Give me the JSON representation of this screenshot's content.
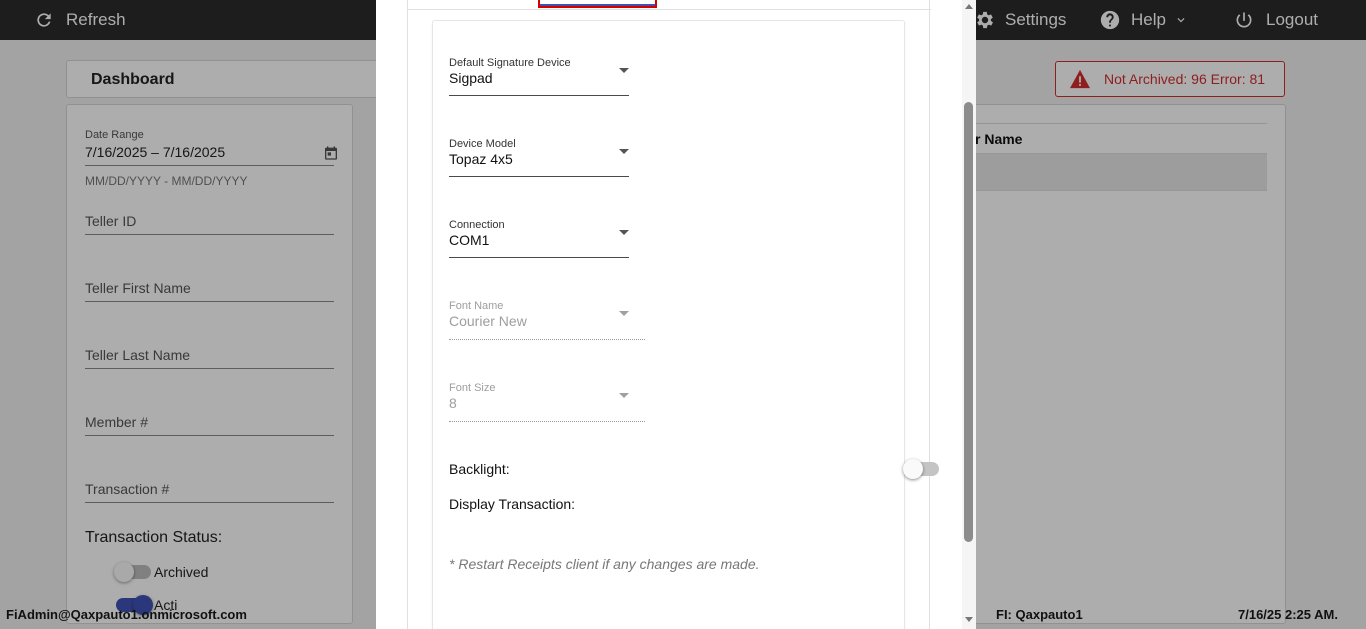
{
  "topbar": {
    "refresh_label": "Refresh",
    "settings_label": "Settings",
    "help_label": "Help",
    "logout_label": "Logout",
    "bg_color": "#2b2b2b"
  },
  "dashboard": {
    "title": "Dashboard",
    "alert": "Not Archived: 96  Error: 81",
    "table_header_partial": "r Name"
  },
  "filters": {
    "date_range_label": "Date Range",
    "date_range_value": "7/16/2025 – 7/16/2025",
    "date_hint": "MM/DD/YYYY - MM/DD/YYYY",
    "teller_id": "Teller ID",
    "teller_first_name": "Teller First Name",
    "teller_last_name": "Teller Last Name",
    "member_number": "Member #",
    "transaction_number": "Transaction #",
    "status_title": "Transaction Status:",
    "archived_label": "Archived",
    "active_partial": "Acti"
  },
  "footer": {
    "user": "FiAdmin@Qaxpauto1.onmicrosoft.com",
    "fi": "FI: Qaxpauto1",
    "datetime": "7/16/25 2:25 AM."
  },
  "settings_form": {
    "device": {
      "label": "Default Signature Device",
      "value": "Sigpad"
    },
    "model": {
      "label": "Device Model",
      "value": "Topaz 4x5"
    },
    "connection": {
      "label": "Connection",
      "value": "COM1"
    },
    "font_name": {
      "label": "Font Name",
      "value": "Courier New"
    },
    "font_size": {
      "label": "Font Size",
      "value": "8"
    },
    "backlight_label": "Backlight:",
    "backlight_on": false,
    "display_transaction_label": "Display Transaction:",
    "display_transaction_on": false,
    "note": "* Restart Receipts client if any changes are made."
  },
  "colors": {
    "accent": "#3f51b5",
    "tab_highlight": "#d50000",
    "alert": "#d32f2f"
  }
}
